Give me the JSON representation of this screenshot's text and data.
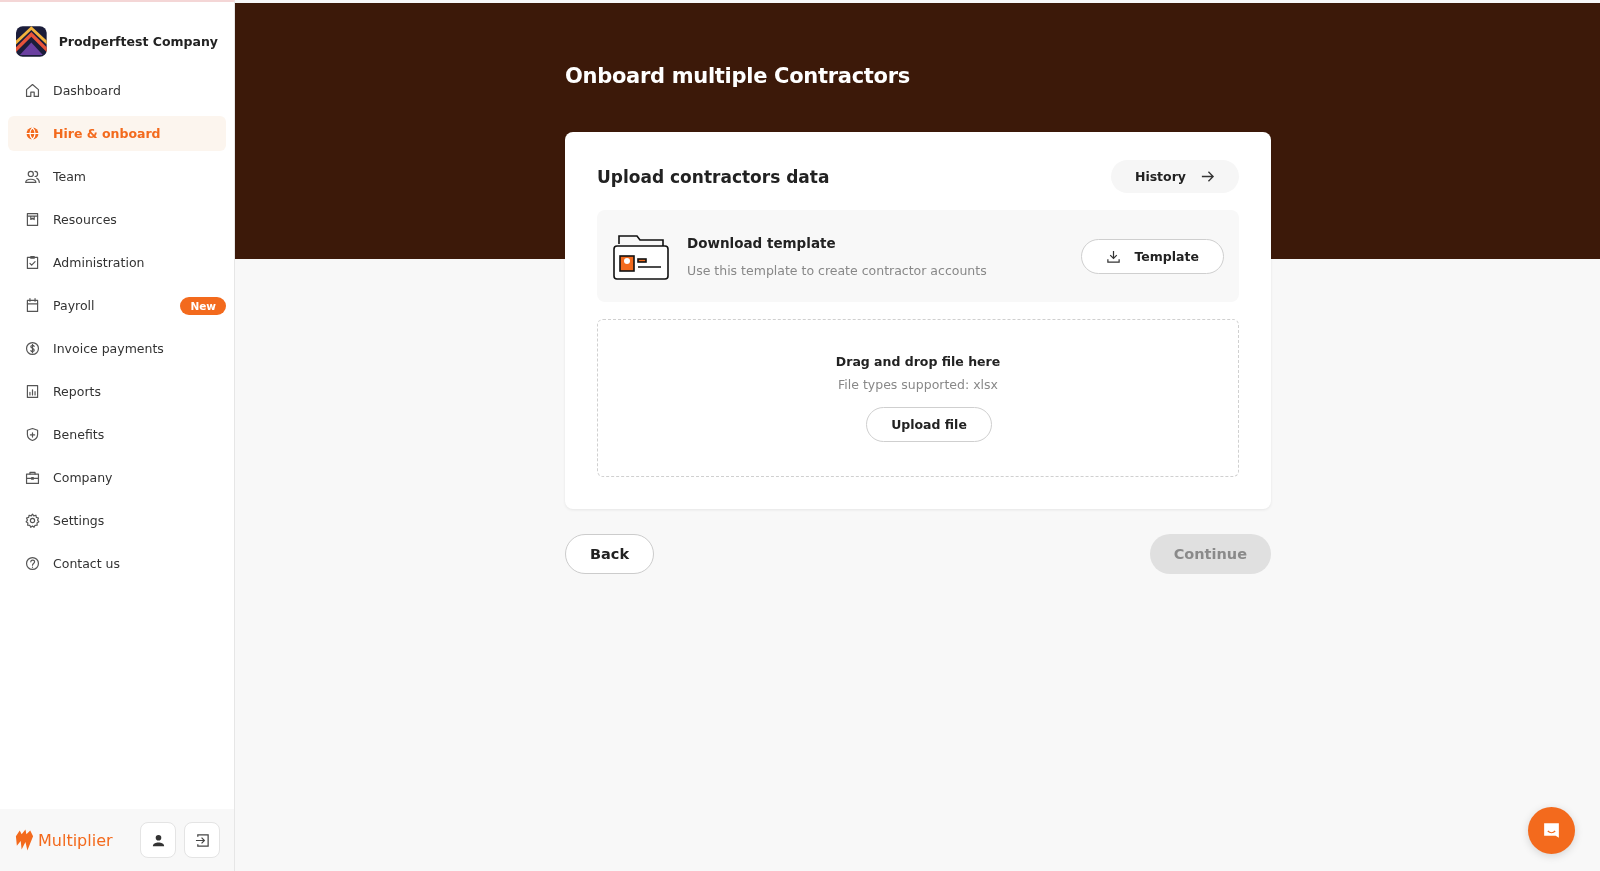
{
  "company": {
    "name": "Prodperftest Company"
  },
  "sidebar": {
    "items": [
      {
        "label": "Dashboard",
        "kind": "home",
        "selected": false
      },
      {
        "label": "Hire & onboard",
        "kind": "globe",
        "selected": true
      },
      {
        "label": "Team",
        "kind": "people",
        "selected": false
      },
      {
        "label": "Resources",
        "kind": "book",
        "selected": false
      },
      {
        "label": "Administration",
        "kind": "clipboard",
        "selected": false
      },
      {
        "label": "Payroll",
        "kind": "calendar",
        "selected": false,
        "badge": "New"
      },
      {
        "label": "Invoice payments",
        "kind": "dollar",
        "selected": false
      },
      {
        "label": "Reports",
        "kind": "chart",
        "selected": false
      },
      {
        "label": "Benefits",
        "kind": "shield",
        "selected": false
      },
      {
        "label": "Company",
        "kind": "briefcase",
        "selected": false
      },
      {
        "label": "Settings",
        "kind": "gear",
        "selected": false
      },
      {
        "label": "Contact us",
        "kind": "help",
        "selected": false
      }
    ]
  },
  "brand": {
    "name": "Multiplier"
  },
  "page": {
    "title": "Onboard multiple Contractors"
  },
  "card": {
    "title": "Upload contractors data",
    "history_button": "History",
    "template": {
      "title": "Download template",
      "description": "Use this template to create contractor accounts",
      "button": "Template"
    },
    "dropzone": {
      "title": "Drag and drop file here",
      "hint": "File types supported: xlsx",
      "button": "Upload file"
    }
  },
  "actions": {
    "back": "Back",
    "continue": {
      "label": "Continue",
      "disabled": true
    }
  }
}
